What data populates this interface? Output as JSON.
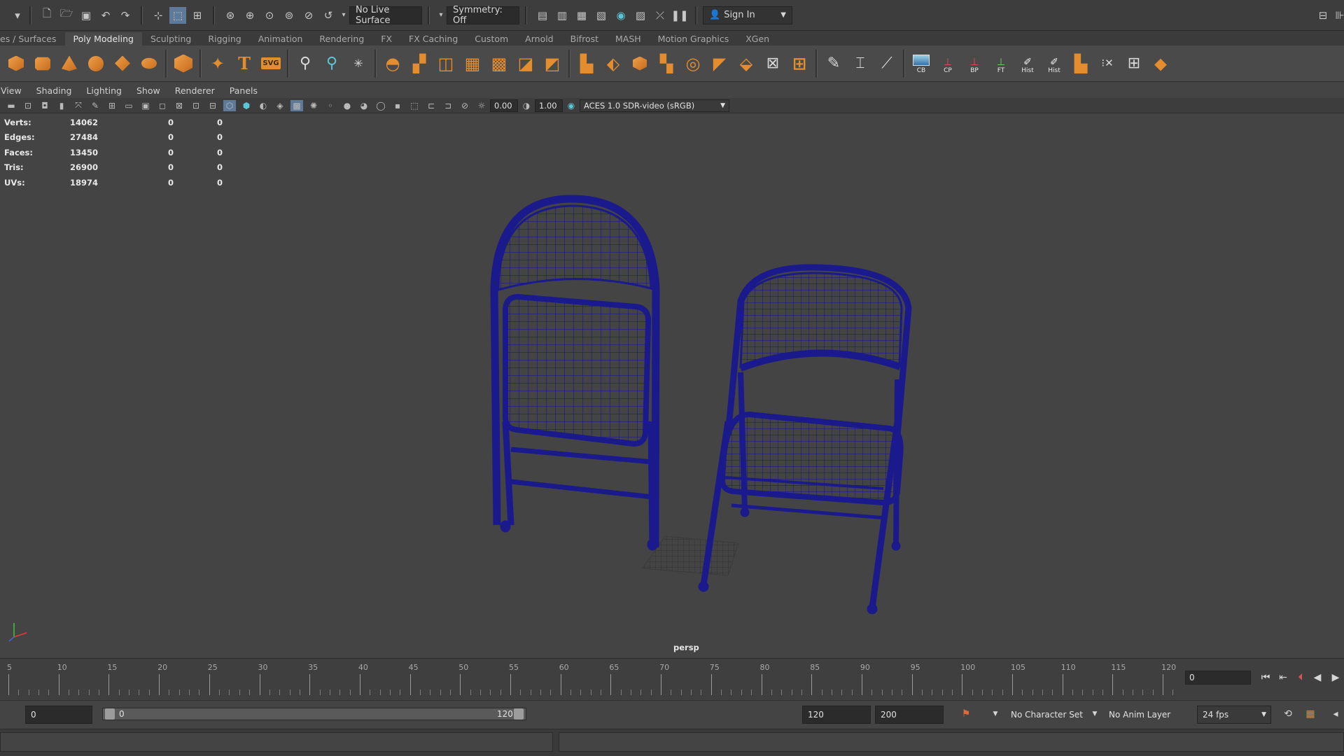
{
  "status_line": {
    "live_surface": "No Live Surface",
    "symmetry": "Symmetry: Off",
    "sign_in": "Sign In"
  },
  "shelf_tabs": [
    "es / Surfaces",
    "Poly Modeling",
    "Sculpting",
    "Rigging",
    "Animation",
    "Rendering",
    "FX",
    "FX Caching",
    "Custom",
    "Arnold",
    "Bifrost",
    "MASH",
    "Motion Graphics",
    "XGen"
  ],
  "active_shelf_tab": "Poly Modeling",
  "shelf": {
    "svg_label": "SVG",
    "labeled_buttons": [
      "CB",
      "CP",
      "BP",
      "FT",
      "Hist",
      "Hist"
    ]
  },
  "panel_menu": [
    "View",
    "Shading",
    "Lighting",
    "Show",
    "Renderer",
    "Panels"
  ],
  "panel_toolbar": {
    "exposure": "0.00",
    "gamma": "1.00",
    "color_space": "ACES 1.0 SDR-video (sRGB)"
  },
  "hud": [
    {
      "label": "Verts:",
      "a": "14062",
      "b": "0",
      "c": "0"
    },
    {
      "label": "Edges:",
      "a": "27484",
      "b": "0",
      "c": "0"
    },
    {
      "label": "Faces:",
      "a": "13450",
      "b": "0",
      "c": "0"
    },
    {
      "label": "Tris:",
      "a": "26900",
      "b": "0",
      "c": "0"
    },
    {
      "label": "UVs:",
      "a": "18974",
      "b": "0",
      "c": "0"
    }
  ],
  "camera_label": "persp",
  "time_slider": {
    "ticks": [
      "5",
      "10",
      "15",
      "20",
      "25",
      "30",
      "35",
      "40",
      "45",
      "50",
      "55",
      "60",
      "65",
      "70",
      "75",
      "80",
      "85",
      "90",
      "95",
      "100",
      "105",
      "110",
      "115",
      "120"
    ],
    "current_frame": "0"
  },
  "range_slider": {
    "start": "0",
    "range_start": "0",
    "range_end": "120",
    "end": "120",
    "anim_end": "200",
    "character_set": "No Character Set",
    "anim_layer": "No Anim Layer",
    "fps": "24 fps"
  },
  "colors": {
    "wireframe": "#1a1a8c",
    "viewport_bg": "#444444",
    "accent_orange": "#e48d2f"
  }
}
